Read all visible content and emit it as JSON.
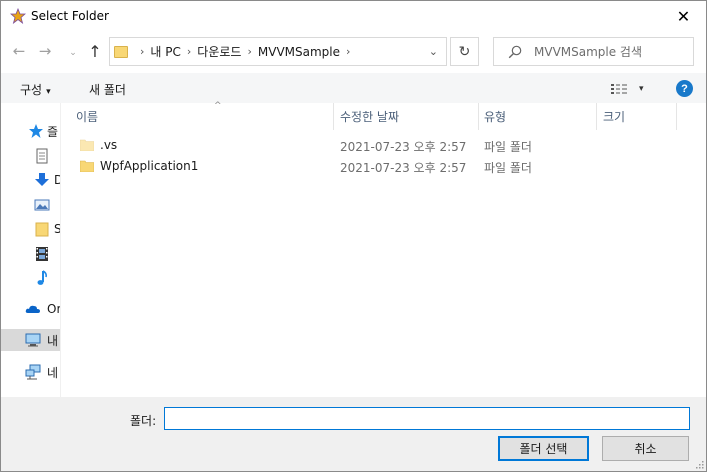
{
  "window": {
    "title": "Select Folder",
    "close_glyph": "✕"
  },
  "nav": {
    "back_glyph": "←",
    "forward_glyph": "→",
    "recent_glyph": "⌄",
    "up_glyph": "↑",
    "breadcrumb": [
      "내 PC",
      "다운로드",
      "MVVMSample"
    ],
    "crumb_sep": "›",
    "dropdown_glyph": "⌄",
    "refresh_glyph": "↻",
    "search_placeholder": "MVVMSample 검색"
  },
  "toolbar": {
    "organize_label": "구성",
    "organize_caret": "▾",
    "new_folder_label": "새 폴더",
    "view_caret": "▾",
    "help_glyph": "?"
  },
  "navpane": {
    "items": [
      {
        "label": "즐",
        "icon": "quick-access-star-icon"
      },
      {
        "label": "",
        "icon": "document-icon"
      },
      {
        "label": "D",
        "icon": "download-arrow-icon"
      },
      {
        "label": "",
        "icon": "picture-icon"
      },
      {
        "label": "S",
        "icon": "folder-icon"
      },
      {
        "label": "",
        "icon": "film-icon"
      },
      {
        "label": "",
        "icon": "music-note-icon"
      },
      {
        "label": "Or",
        "icon": "onedrive-cloud-icon"
      },
      {
        "label": "내",
        "icon": "this-pc-icon"
      },
      {
        "label": "네",
        "icon": "network-icon"
      }
    ]
  },
  "columns": {
    "name": "이름",
    "sort_glyph": "^",
    "date": "수정한 날짜",
    "type": "유형",
    "size": "크기"
  },
  "files": [
    {
      "name": ".vs",
      "date": "2021-07-23 오후 2:57",
      "type": "파일 폴더"
    },
    {
      "name": "WpfApplication1",
      "date": "2021-07-23 오후 2:57",
      "type": "파일 폴더"
    }
  ],
  "footer": {
    "folder_label": "폴더:",
    "folder_value": "",
    "select_button": "폴더 선택",
    "cancel_button": "취소"
  },
  "colors": {
    "accent": "#0078d7",
    "folder_yellow": "#f8d775",
    "help_blue": "#1979ca"
  }
}
